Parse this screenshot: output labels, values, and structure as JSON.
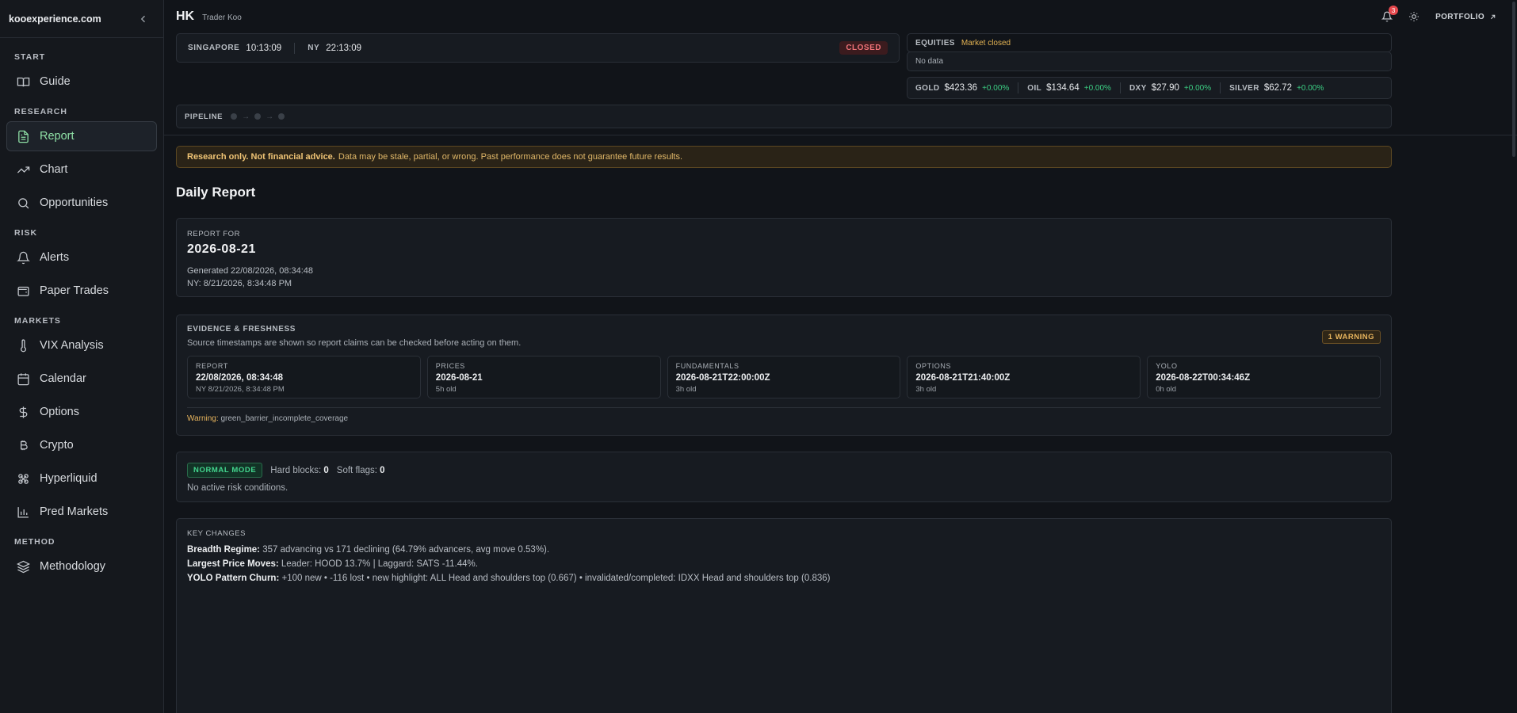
{
  "sidebar": {
    "site": "kooexperience.com",
    "sections": [
      {
        "title": "START",
        "items": [
          {
            "label": "Guide",
            "icon": "book-icon"
          }
        ]
      },
      {
        "title": "RESEARCH",
        "items": [
          {
            "label": "Report",
            "icon": "document-icon",
            "active": true
          },
          {
            "label": "Chart",
            "icon": "trend-icon"
          },
          {
            "label": "Opportunities",
            "icon": "search-icon"
          }
        ]
      },
      {
        "title": "RISK",
        "items": [
          {
            "label": "Alerts",
            "icon": "bell-icon"
          },
          {
            "label": "Paper Trades",
            "icon": "wallet-icon"
          }
        ]
      },
      {
        "title": "MARKETS",
        "items": [
          {
            "label": "VIX Analysis",
            "icon": "thermometer-icon"
          },
          {
            "label": "Calendar",
            "icon": "calendar-icon"
          },
          {
            "label": "Options",
            "icon": "dollar-icon"
          },
          {
            "label": "Crypto",
            "icon": "bitcoin-icon"
          },
          {
            "label": "Hyperliquid",
            "icon": "hyperliquid-icon"
          },
          {
            "label": "Pred Markets",
            "icon": "bar-chart-icon"
          }
        ]
      },
      {
        "title": "METHOD",
        "items": [
          {
            "label": "Methodology",
            "icon": "layers-icon"
          }
        ]
      }
    ]
  },
  "topbar": {
    "market": "HK",
    "user": "Trader Koo",
    "notifications": "3",
    "portfolio": "PORTFOLIO"
  },
  "clock": {
    "city1": "SINGAPORE",
    "time1": "10:13:09",
    "city2": "NY",
    "time2": "22:13:09",
    "status": "CLOSED"
  },
  "equities": {
    "label": "EQUITIES",
    "status": "Market closed",
    "nodata": "No data"
  },
  "commodities": [
    {
      "name": "GOLD",
      "price": "$423.36",
      "change": "+0.00%"
    },
    {
      "name": "OIL",
      "price": "$134.64",
      "change": "+0.00%"
    },
    {
      "name": "DXY",
      "price": "$27.90",
      "change": "+0.00%"
    },
    {
      "name": "SILVER",
      "price": "$62.72",
      "change": "+0.00%"
    }
  ],
  "pipeline": {
    "label": "PIPELINE"
  },
  "disclaimer": {
    "bold": "Research only. Not financial advice.",
    "text": "Data may be stale, partial, or wrong. Past performance does not guarantee future results."
  },
  "page": {
    "title": "Daily Report"
  },
  "report": {
    "label": "REPORT FOR",
    "date": "2026-08-21",
    "generated": "Generated 22/08/2026, 08:34:48",
    "ny": "NY: 8/21/2026, 8:34:48 PM"
  },
  "evidence": {
    "title": "EVIDENCE & FRESHNESS",
    "subtitle": "Source timestamps are shown so report claims can be checked before acting on them.",
    "badge": "1 WARNING",
    "boxes": [
      {
        "label": "REPORT",
        "value": "22/08/2026, 08:34:48",
        "sub": "NY 8/21/2026, 8:34:48 PM"
      },
      {
        "label": "PRICES",
        "value": "2026-08-21",
        "sub": "5h old"
      },
      {
        "label": "FUNDAMENTALS",
        "value": "2026-08-21T22:00:00Z",
        "sub": "3h old"
      },
      {
        "label": "OPTIONS",
        "value": "2026-08-21T21:40:00Z",
        "sub": "3h old"
      },
      {
        "label": "YOLO",
        "value": "2026-08-22T00:34:46Z",
        "sub": "0h old"
      }
    ],
    "warning_label": "Warning:",
    "warning_text": "green_barrier_incomplete_coverage"
  },
  "mode": {
    "badge": "NORMAL MODE",
    "hard_label": "Hard blocks:",
    "hard_value": "0",
    "soft_label": "Soft flags:",
    "soft_value": "0",
    "note": "No active risk conditions."
  },
  "key_changes": {
    "title": "KEY CHANGES",
    "lines": [
      {
        "label": "Breadth Regime:",
        "text": "357 advancing vs 171 declining (64.79% advancers, avg move 0.53%)."
      },
      {
        "label": "Largest Price Moves:",
        "text": "Leader: HOOD 13.7% | Laggard: SATS -11.44%."
      },
      {
        "label": "YOLO Pattern Churn:",
        "text": "+100 new • -116 lost • new highlight: ALL Head and shoulders top (0.667) • invalidated/completed: IDXX Head and shoulders top (0.836)"
      }
    ]
  },
  "colors": {
    "accent_green": "#8fe0a6",
    "closed_red": "#f07378",
    "warning_amber": "#e7b45d",
    "positive": "#3ccf84"
  }
}
